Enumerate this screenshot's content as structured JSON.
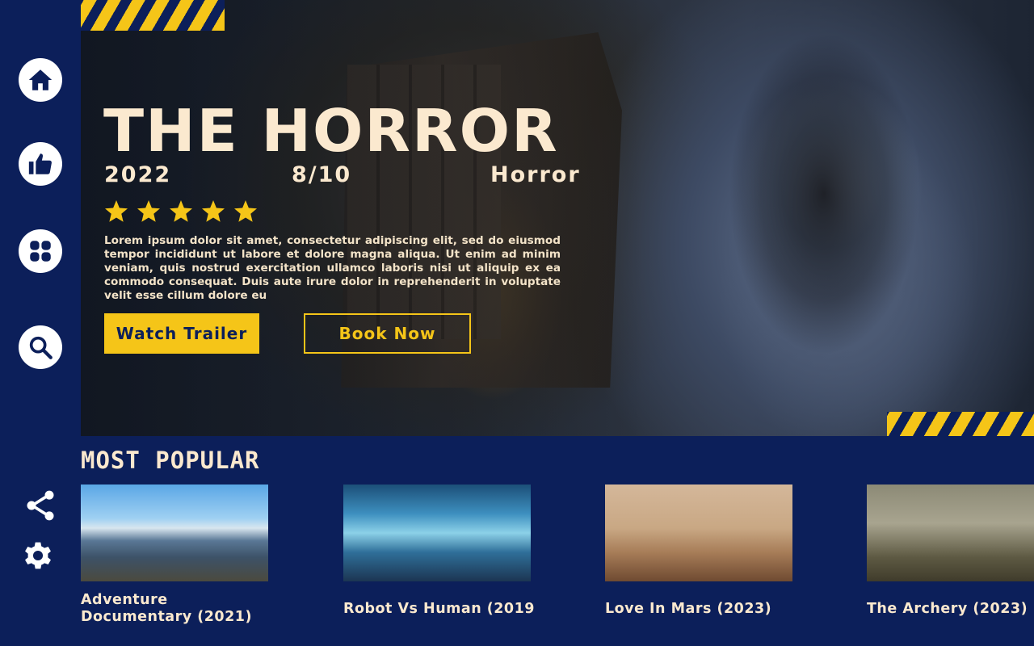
{
  "sidebar": {
    "items": [
      {
        "name": "home",
        "icon": "home-icon"
      },
      {
        "name": "likes",
        "icon": "thumbs-up-icon"
      },
      {
        "name": "categories",
        "icon": "grid-icon"
      },
      {
        "name": "search",
        "icon": "search-icon"
      }
    ],
    "bottom_items": [
      {
        "name": "share",
        "icon": "share-icon"
      },
      {
        "name": "settings",
        "icon": "gear-icon"
      }
    ]
  },
  "hero": {
    "title": "THE HORROR",
    "year": "2022",
    "rating": "8/10",
    "genre": "Horror",
    "stars": 5,
    "description": "Lorem ipsum dolor sit amet, consectetur adipiscing elit, sed do eiusmod tempor incididunt ut labore et dolore magna aliqua. Ut enim ad minim veniam, quis nostrud exercitation ullamco laboris nisi ut aliquip ex ea commodo consequat. Duis aute irure dolor in reprehenderit in voluptate velit esse cillum dolore eu",
    "watch_trailer_label": "Watch Trailer",
    "book_now_label": "Book Now"
  },
  "popular": {
    "title": "MOST POPULAR",
    "items": [
      {
        "title": "Adventure Documentary (2021)"
      },
      {
        "title": "Robot Vs Human (2019"
      },
      {
        "title": "Love In Mars (2023)"
      },
      {
        "title": "The Archery (2023)"
      }
    ]
  },
  "colors": {
    "background": "#0c1f5a",
    "accent": "#f5c518",
    "text": "#fbe9cf"
  }
}
